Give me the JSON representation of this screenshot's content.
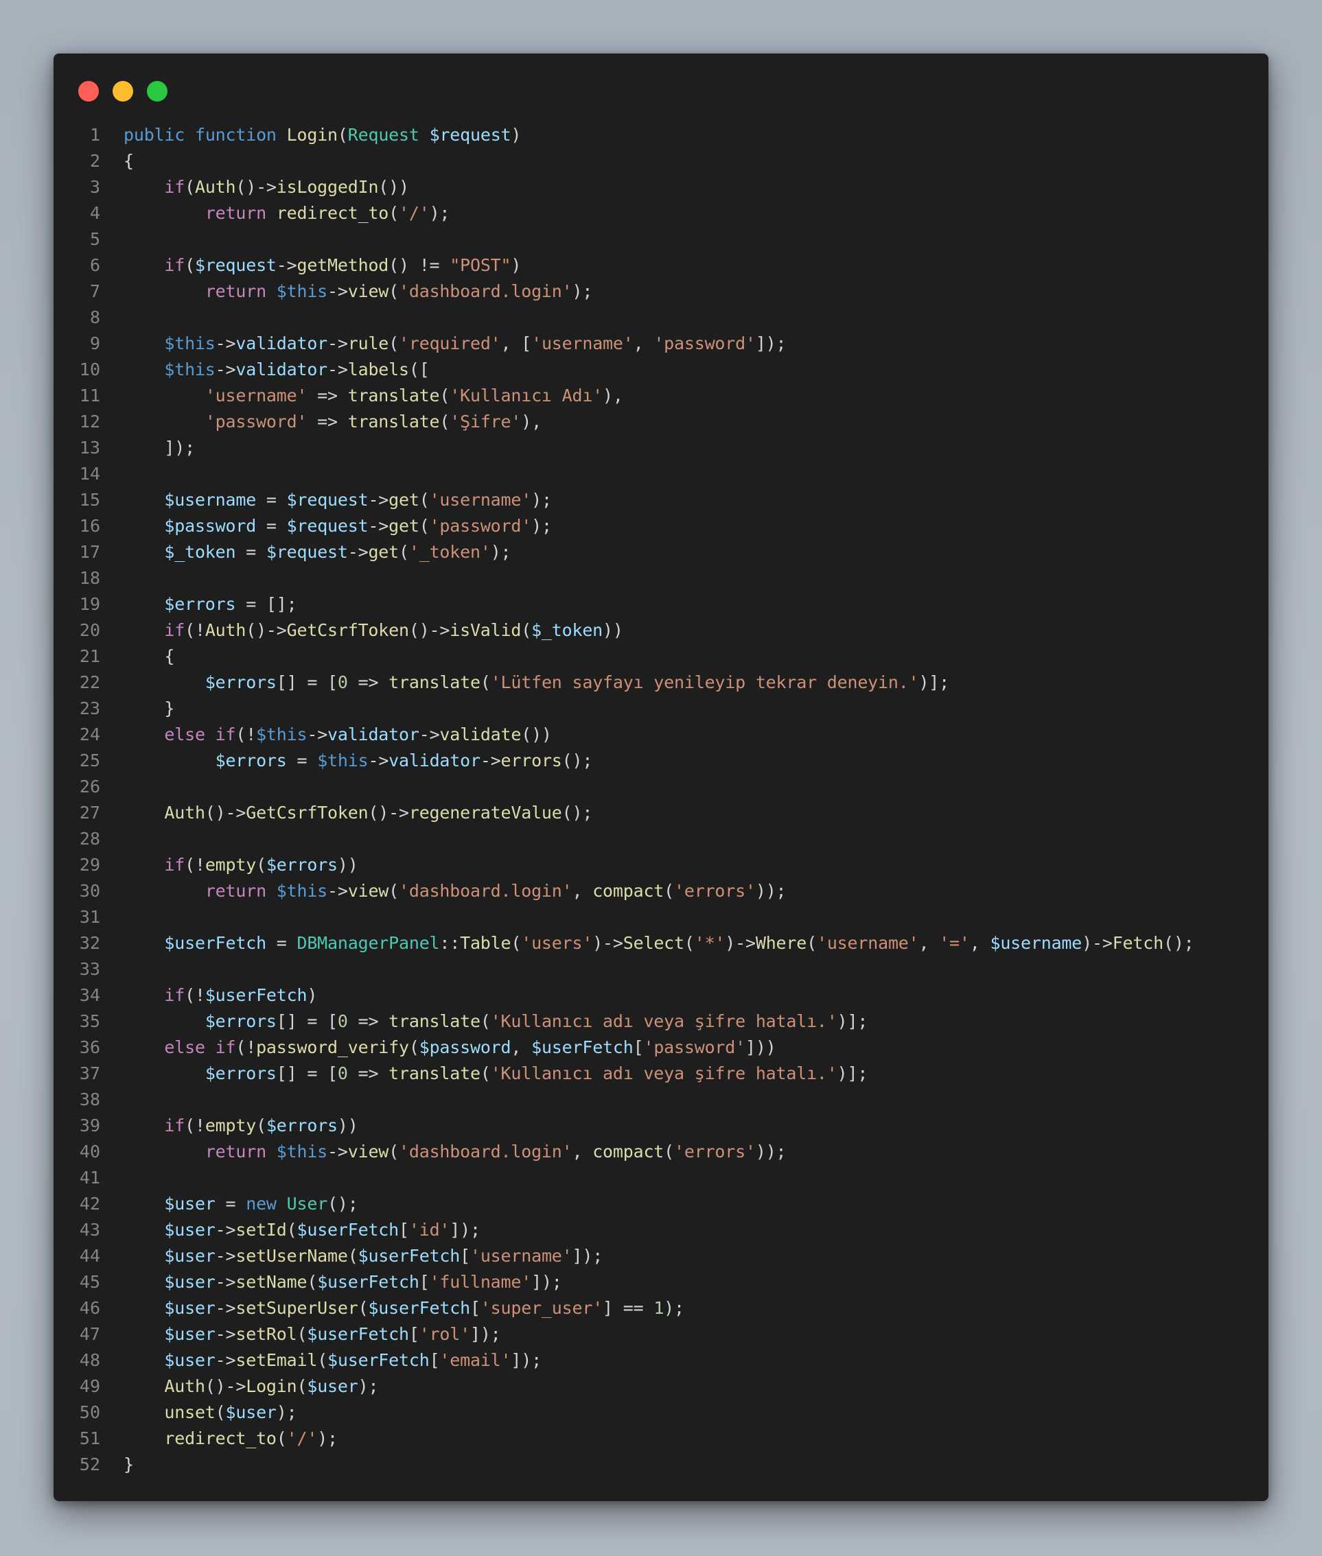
{
  "window": {
    "controls": [
      {
        "name": "close",
        "color": "#ff5f57"
      },
      {
        "name": "minimize",
        "color": "#febc2e"
      },
      {
        "name": "zoom",
        "color": "#28c840"
      }
    ]
  },
  "code": {
    "language": "php",
    "lines": [
      [
        [
          "kw",
          "public"
        ],
        [
          "pn",
          " "
        ],
        [
          "kw",
          "function"
        ],
        [
          "pn",
          " "
        ],
        [
          "fn",
          "Login"
        ],
        [
          "pn",
          "("
        ],
        [
          "ty",
          "Request"
        ],
        [
          "pn",
          " "
        ],
        [
          "var",
          "$request"
        ],
        [
          "pn",
          ")"
        ]
      ],
      [
        [
          "pn",
          "{"
        ]
      ],
      [
        [
          "pn",
          "    "
        ],
        [
          "ctl",
          "if"
        ],
        [
          "pn",
          "("
        ],
        [
          "fn",
          "Auth"
        ],
        [
          "pn",
          "()->"
        ],
        [
          "fn",
          "isLoggedIn"
        ],
        [
          "pn",
          "())"
        ]
      ],
      [
        [
          "pn",
          "        "
        ],
        [
          "ctl",
          "return"
        ],
        [
          "pn",
          " "
        ],
        [
          "fn",
          "redirect_to"
        ],
        [
          "pn",
          "("
        ],
        [
          "str",
          "'/'"
        ],
        [
          "pn",
          ");"
        ]
      ],
      [],
      [
        [
          "pn",
          "    "
        ],
        [
          "ctl",
          "if"
        ],
        [
          "pn",
          "("
        ],
        [
          "var",
          "$request"
        ],
        [
          "pn",
          "->"
        ],
        [
          "fn",
          "getMethod"
        ],
        [
          "pn",
          "() != "
        ],
        [
          "str",
          "\"POST\""
        ],
        [
          "pn",
          ")"
        ]
      ],
      [
        [
          "pn",
          "        "
        ],
        [
          "ctl",
          "return"
        ],
        [
          "pn",
          " "
        ],
        [
          "kw",
          "$this"
        ],
        [
          "pn",
          "->"
        ],
        [
          "fn",
          "view"
        ],
        [
          "pn",
          "("
        ],
        [
          "str",
          "'dashboard.login'"
        ],
        [
          "pn",
          ");"
        ]
      ],
      [],
      [
        [
          "pn",
          "    "
        ],
        [
          "kw",
          "$this"
        ],
        [
          "pn",
          "->"
        ],
        [
          "var",
          "validator"
        ],
        [
          "pn",
          "->"
        ],
        [
          "fn",
          "rule"
        ],
        [
          "pn",
          "("
        ],
        [
          "str",
          "'required'"
        ],
        [
          "pn",
          ", ["
        ],
        [
          "str",
          "'username'"
        ],
        [
          "pn",
          ", "
        ],
        [
          "str",
          "'password'"
        ],
        [
          "pn",
          "]);"
        ]
      ],
      [
        [
          "pn",
          "    "
        ],
        [
          "kw",
          "$this"
        ],
        [
          "pn",
          "->"
        ],
        [
          "var",
          "validator"
        ],
        [
          "pn",
          "->"
        ],
        [
          "fn",
          "labels"
        ],
        [
          "pn",
          "(["
        ]
      ],
      [
        [
          "pn",
          "        "
        ],
        [
          "str",
          "'username'"
        ],
        [
          "pn",
          " => "
        ],
        [
          "fn",
          "translate"
        ],
        [
          "pn",
          "("
        ],
        [
          "str",
          "'Kullanıcı Adı'"
        ],
        [
          "pn",
          "),"
        ]
      ],
      [
        [
          "pn",
          "        "
        ],
        [
          "str",
          "'password'"
        ],
        [
          "pn",
          " => "
        ],
        [
          "fn",
          "translate"
        ],
        [
          "pn",
          "("
        ],
        [
          "str",
          "'Şifre'"
        ],
        [
          "pn",
          "),"
        ]
      ],
      [
        [
          "pn",
          "    ]);"
        ]
      ],
      [],
      [
        [
          "pn",
          "    "
        ],
        [
          "var",
          "$username"
        ],
        [
          "pn",
          " = "
        ],
        [
          "var",
          "$request"
        ],
        [
          "pn",
          "->"
        ],
        [
          "fn",
          "get"
        ],
        [
          "pn",
          "("
        ],
        [
          "str",
          "'username'"
        ],
        [
          "pn",
          ");"
        ]
      ],
      [
        [
          "pn",
          "    "
        ],
        [
          "var",
          "$password"
        ],
        [
          "pn",
          " = "
        ],
        [
          "var",
          "$request"
        ],
        [
          "pn",
          "->"
        ],
        [
          "fn",
          "get"
        ],
        [
          "pn",
          "("
        ],
        [
          "str",
          "'password'"
        ],
        [
          "pn",
          ");"
        ]
      ],
      [
        [
          "pn",
          "    "
        ],
        [
          "var",
          "$_token"
        ],
        [
          "pn",
          " = "
        ],
        [
          "var",
          "$request"
        ],
        [
          "pn",
          "->"
        ],
        [
          "fn",
          "get"
        ],
        [
          "pn",
          "("
        ],
        [
          "str",
          "'_token'"
        ],
        [
          "pn",
          ");"
        ]
      ],
      [],
      [
        [
          "pn",
          "    "
        ],
        [
          "var",
          "$errors"
        ],
        [
          "pn",
          " = [];"
        ]
      ],
      [
        [
          "pn",
          "    "
        ],
        [
          "ctl",
          "if"
        ],
        [
          "pn",
          "(!"
        ],
        [
          "fn",
          "Auth"
        ],
        [
          "pn",
          "()->"
        ],
        [
          "fn",
          "GetCsrfToken"
        ],
        [
          "pn",
          "()->"
        ],
        [
          "fn",
          "isValid"
        ],
        [
          "pn",
          "("
        ],
        [
          "var",
          "$_token"
        ],
        [
          "pn",
          "))"
        ]
      ],
      [
        [
          "pn",
          "    {"
        ]
      ],
      [
        [
          "pn",
          "        "
        ],
        [
          "var",
          "$errors"
        ],
        [
          "pn",
          "[] = ["
        ],
        [
          "num",
          "0"
        ],
        [
          "pn",
          " => "
        ],
        [
          "fn",
          "translate"
        ],
        [
          "pn",
          "("
        ],
        [
          "str",
          "'Lütfen sayfayı yenileyip tekrar deneyin.'"
        ],
        [
          "pn",
          ")];"
        ]
      ],
      [
        [
          "pn",
          "    }"
        ]
      ],
      [
        [
          "pn",
          "    "
        ],
        [
          "ctl",
          "else"
        ],
        [
          "pn",
          " "
        ],
        [
          "ctl",
          "if"
        ],
        [
          "pn",
          "(!"
        ],
        [
          "kw",
          "$this"
        ],
        [
          "pn",
          "->"
        ],
        [
          "var",
          "validator"
        ],
        [
          "pn",
          "->"
        ],
        [
          "fn",
          "validate"
        ],
        [
          "pn",
          "())"
        ]
      ],
      [
        [
          "pn",
          "         "
        ],
        [
          "var",
          "$errors"
        ],
        [
          "pn",
          " = "
        ],
        [
          "kw",
          "$this"
        ],
        [
          "pn",
          "->"
        ],
        [
          "var",
          "validator"
        ],
        [
          "pn",
          "->"
        ],
        [
          "fn",
          "errors"
        ],
        [
          "pn",
          "();"
        ]
      ],
      [],
      [
        [
          "pn",
          "    "
        ],
        [
          "fn",
          "Auth"
        ],
        [
          "pn",
          "()->"
        ],
        [
          "fn",
          "GetCsrfToken"
        ],
        [
          "pn",
          "()->"
        ],
        [
          "fn",
          "regenerateValue"
        ],
        [
          "pn",
          "();"
        ]
      ],
      [],
      [
        [
          "pn",
          "    "
        ],
        [
          "ctl",
          "if"
        ],
        [
          "pn",
          "(!"
        ],
        [
          "fn",
          "empty"
        ],
        [
          "pn",
          "("
        ],
        [
          "var",
          "$errors"
        ],
        [
          "pn",
          "))"
        ]
      ],
      [
        [
          "pn",
          "        "
        ],
        [
          "ctl",
          "return"
        ],
        [
          "pn",
          " "
        ],
        [
          "kw",
          "$this"
        ],
        [
          "pn",
          "->"
        ],
        [
          "fn",
          "view"
        ],
        [
          "pn",
          "("
        ],
        [
          "str",
          "'dashboard.login'"
        ],
        [
          "pn",
          ", "
        ],
        [
          "fn",
          "compact"
        ],
        [
          "pn",
          "("
        ],
        [
          "str",
          "'errors'"
        ],
        [
          "pn",
          "));"
        ]
      ],
      [],
      [
        [
          "pn",
          "    "
        ],
        [
          "var",
          "$userFetch"
        ],
        [
          "pn",
          " = "
        ],
        [
          "ty",
          "DBManagerPanel"
        ],
        [
          "pn",
          "::"
        ],
        [
          "fn",
          "Table"
        ],
        [
          "pn",
          "("
        ],
        [
          "str",
          "'users'"
        ],
        [
          "pn",
          ")->"
        ],
        [
          "fn",
          "Select"
        ],
        [
          "pn",
          "("
        ],
        [
          "str",
          "'*'"
        ],
        [
          "pn",
          ")->"
        ],
        [
          "fn",
          "Where"
        ],
        [
          "pn",
          "("
        ],
        [
          "str",
          "'username'"
        ],
        [
          "pn",
          ", "
        ],
        [
          "str",
          "'='"
        ],
        [
          "pn",
          ", "
        ],
        [
          "var",
          "$username"
        ],
        [
          "pn",
          ")->"
        ],
        [
          "fn",
          "Fetch"
        ],
        [
          "pn",
          "();"
        ]
      ],
      [],
      [
        [
          "pn",
          "    "
        ],
        [
          "ctl",
          "if"
        ],
        [
          "pn",
          "(!"
        ],
        [
          "var",
          "$userFetch"
        ],
        [
          "pn",
          ")"
        ]
      ],
      [
        [
          "pn",
          "        "
        ],
        [
          "var",
          "$errors"
        ],
        [
          "pn",
          "[] = ["
        ],
        [
          "num",
          "0"
        ],
        [
          "pn",
          " => "
        ],
        [
          "fn",
          "translate"
        ],
        [
          "pn",
          "("
        ],
        [
          "str",
          "'Kullanıcı adı veya şifre hatalı.'"
        ],
        [
          "pn",
          ")];"
        ]
      ],
      [
        [
          "pn",
          "    "
        ],
        [
          "ctl",
          "else"
        ],
        [
          "pn",
          " "
        ],
        [
          "ctl",
          "if"
        ],
        [
          "pn",
          "(!"
        ],
        [
          "fn",
          "password_verify"
        ],
        [
          "pn",
          "("
        ],
        [
          "var",
          "$password"
        ],
        [
          "pn",
          ", "
        ],
        [
          "var",
          "$userFetch"
        ],
        [
          "pn",
          "["
        ],
        [
          "str",
          "'password'"
        ],
        [
          "pn",
          "]))"
        ]
      ],
      [
        [
          "pn",
          "        "
        ],
        [
          "var",
          "$errors"
        ],
        [
          "pn",
          "[] = ["
        ],
        [
          "num",
          "0"
        ],
        [
          "pn",
          " => "
        ],
        [
          "fn",
          "translate"
        ],
        [
          "pn",
          "("
        ],
        [
          "str",
          "'Kullanıcı adı veya şifre hatalı.'"
        ],
        [
          "pn",
          ")];"
        ]
      ],
      [],
      [
        [
          "pn",
          "    "
        ],
        [
          "ctl",
          "if"
        ],
        [
          "pn",
          "(!"
        ],
        [
          "fn",
          "empty"
        ],
        [
          "pn",
          "("
        ],
        [
          "var",
          "$errors"
        ],
        [
          "pn",
          "))"
        ]
      ],
      [
        [
          "pn",
          "        "
        ],
        [
          "ctl",
          "return"
        ],
        [
          "pn",
          " "
        ],
        [
          "kw",
          "$this"
        ],
        [
          "pn",
          "->"
        ],
        [
          "fn",
          "view"
        ],
        [
          "pn",
          "("
        ],
        [
          "str",
          "'dashboard.login'"
        ],
        [
          "pn",
          ", "
        ],
        [
          "fn",
          "compact"
        ],
        [
          "pn",
          "("
        ],
        [
          "str",
          "'errors'"
        ],
        [
          "pn",
          "));"
        ]
      ],
      [],
      [
        [
          "pn",
          "    "
        ],
        [
          "var",
          "$user"
        ],
        [
          "pn",
          " = "
        ],
        [
          "kw",
          "new"
        ],
        [
          "pn",
          " "
        ],
        [
          "ty",
          "User"
        ],
        [
          "pn",
          "();"
        ]
      ],
      [
        [
          "pn",
          "    "
        ],
        [
          "var",
          "$user"
        ],
        [
          "pn",
          "->"
        ],
        [
          "fn",
          "setId"
        ],
        [
          "pn",
          "("
        ],
        [
          "var",
          "$userFetch"
        ],
        [
          "pn",
          "["
        ],
        [
          "str",
          "'id'"
        ],
        [
          "pn",
          "]);"
        ]
      ],
      [
        [
          "pn",
          "    "
        ],
        [
          "var",
          "$user"
        ],
        [
          "pn",
          "->"
        ],
        [
          "fn",
          "setUserName"
        ],
        [
          "pn",
          "("
        ],
        [
          "var",
          "$userFetch"
        ],
        [
          "pn",
          "["
        ],
        [
          "str",
          "'username'"
        ],
        [
          "pn",
          "]);"
        ]
      ],
      [
        [
          "pn",
          "    "
        ],
        [
          "var",
          "$user"
        ],
        [
          "pn",
          "->"
        ],
        [
          "fn",
          "setName"
        ],
        [
          "pn",
          "("
        ],
        [
          "var",
          "$userFetch"
        ],
        [
          "pn",
          "["
        ],
        [
          "str",
          "'fullname'"
        ],
        [
          "pn",
          "]);"
        ]
      ],
      [
        [
          "pn",
          "    "
        ],
        [
          "var",
          "$user"
        ],
        [
          "pn",
          "->"
        ],
        [
          "fn",
          "setSuperUser"
        ],
        [
          "pn",
          "("
        ],
        [
          "var",
          "$userFetch"
        ],
        [
          "pn",
          "["
        ],
        [
          "str",
          "'super_user'"
        ],
        [
          "pn",
          "] == "
        ],
        [
          "num",
          "1"
        ],
        [
          "pn",
          ");"
        ]
      ],
      [
        [
          "pn",
          "    "
        ],
        [
          "var",
          "$user"
        ],
        [
          "pn",
          "->"
        ],
        [
          "fn",
          "setRol"
        ],
        [
          "pn",
          "("
        ],
        [
          "var",
          "$userFetch"
        ],
        [
          "pn",
          "["
        ],
        [
          "str",
          "'rol'"
        ],
        [
          "pn",
          "]);"
        ]
      ],
      [
        [
          "pn",
          "    "
        ],
        [
          "var",
          "$user"
        ],
        [
          "pn",
          "->"
        ],
        [
          "fn",
          "setEmail"
        ],
        [
          "pn",
          "("
        ],
        [
          "var",
          "$userFetch"
        ],
        [
          "pn",
          "["
        ],
        [
          "str",
          "'email'"
        ],
        [
          "pn",
          "]);"
        ]
      ],
      [
        [
          "pn",
          "    "
        ],
        [
          "fn",
          "Auth"
        ],
        [
          "pn",
          "()->"
        ],
        [
          "fn",
          "Login"
        ],
        [
          "pn",
          "("
        ],
        [
          "var",
          "$user"
        ],
        [
          "pn",
          ");"
        ]
      ],
      [
        [
          "pn",
          "    "
        ],
        [
          "fn",
          "unset"
        ],
        [
          "pn",
          "("
        ],
        [
          "var",
          "$user"
        ],
        [
          "pn",
          ");"
        ]
      ],
      [
        [
          "pn",
          "    "
        ],
        [
          "fn",
          "redirect_to"
        ],
        [
          "pn",
          "("
        ],
        [
          "str",
          "'/'"
        ],
        [
          "pn",
          ");"
        ]
      ],
      [
        [
          "pn",
          "}"
        ]
      ]
    ]
  }
}
